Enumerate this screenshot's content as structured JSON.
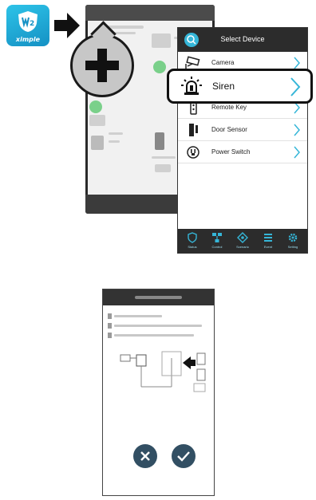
{
  "app": {
    "brand": "ximple",
    "logo_icon": "w2-shield-icon",
    "accent_color": "#35b6d8"
  },
  "select_device": {
    "title": "Select Device",
    "devices": [
      {
        "label": "Camera",
        "icon": "camera-icon"
      },
      {
        "label": "Siren",
        "icon": "siren-icon"
      },
      {
        "label": "Remote Key",
        "icon": "remote-key-icon"
      },
      {
        "label": "Door Sensor",
        "icon": "door-sensor-icon"
      },
      {
        "label": "Power Switch",
        "icon": "power-switch-icon"
      }
    ],
    "highlighted": "Siren",
    "tabs": [
      {
        "label": "Status",
        "icon": "shield-icon"
      },
      {
        "label": "Control",
        "icon": "network-icon"
      },
      {
        "label": "Scenario",
        "icon": "diamond-icon"
      },
      {
        "label": "Event",
        "icon": "list-icon"
      },
      {
        "label": "Setting",
        "icon": "gear-icon"
      }
    ]
  },
  "instruction_screen": {
    "buttons": [
      {
        "icon": "close-icon"
      },
      {
        "icon": "confirm-icon"
      }
    ]
  }
}
